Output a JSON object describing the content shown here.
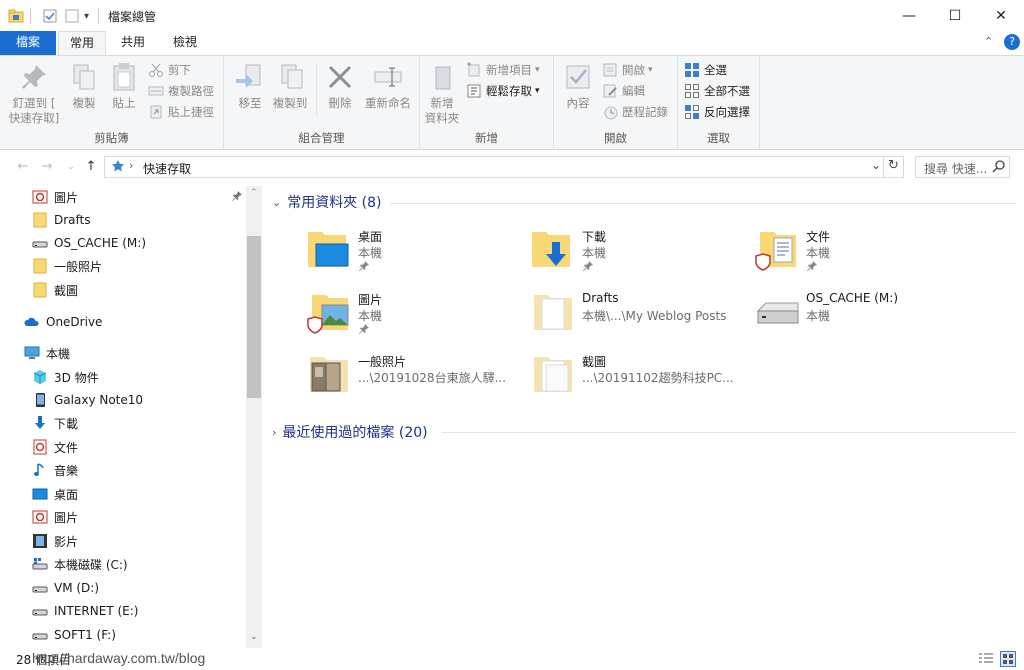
{
  "window": {
    "title": "檔案總管",
    "minimize": "—",
    "maximize": "☐",
    "close": "✕"
  },
  "tabs": [
    {
      "label": "檔案"
    },
    {
      "label": "常用"
    },
    {
      "label": "共用"
    },
    {
      "label": "檢視"
    }
  ],
  "ribbon": {
    "groups": {
      "clipboard": "剪貼簿",
      "organize": "組合管理",
      "new": "新增",
      "open": "開啟",
      "select": "選取"
    },
    "buttons": {
      "pin_line1": "釘選到 [",
      "pin_line2": "快速存取]",
      "copy": "複製",
      "paste": "貼上",
      "cut": "剪下",
      "copy_path": "複製路徑",
      "paste_shortcut": "貼上捷徑",
      "move_to": "移至",
      "copy_to": "複製到",
      "delete": "刪除",
      "rename": "重新命名",
      "new_folder_line1": "新增",
      "new_folder_line2": "資料夾",
      "new_item": "新增項目",
      "easy_access": "輕鬆存取",
      "properties": "內容",
      "open": "開啟",
      "edit": "編輯",
      "history": "歷程記錄",
      "select_all": "全選",
      "select_none": "全部不選",
      "invert_selection": "反向選擇"
    }
  },
  "address": {
    "path": "快速存取",
    "search_placeholder": "搜尋 快速..."
  },
  "navpane": {
    "items": [
      {
        "label": "圖片",
        "icon": "pictures-icon"
      },
      {
        "label": "Drafts",
        "icon": "folder-icon"
      },
      {
        "label": "OS_CACHE (M:)",
        "icon": "drive-icon"
      },
      {
        "label": "一般照片",
        "icon": "folder-icon"
      },
      {
        "label": "截圖",
        "icon": "folder-icon"
      },
      {
        "label": "OneDrive",
        "icon": "onedrive-icon"
      },
      {
        "label": "本機",
        "icon": "computer-icon"
      },
      {
        "label": "3D 物件",
        "icon": "3d-objects-icon"
      },
      {
        "label": "Galaxy Note10",
        "icon": "phone-icon"
      },
      {
        "label": "下載",
        "icon": "downloads-icon"
      },
      {
        "label": "文件",
        "icon": "documents-icon"
      },
      {
        "label": "音樂",
        "icon": "music-icon"
      },
      {
        "label": "桌面",
        "icon": "desktop-icon"
      },
      {
        "label": "圖片",
        "icon": "pictures-icon"
      },
      {
        "label": "影片",
        "icon": "videos-icon"
      },
      {
        "label": "本機磁碟 (C:)",
        "icon": "system-drive-icon"
      },
      {
        "label": "VM (D:)",
        "icon": "drive-icon"
      },
      {
        "label": "INTERNET (E:)",
        "icon": "drive-icon"
      },
      {
        "label": "SOFT1 (F:)",
        "icon": "drive-icon"
      }
    ]
  },
  "content": {
    "frequent_header": "常用資料夾 (8)",
    "recent_header": "最近使用過的檔案 (20)",
    "tiles": [
      {
        "name": "桌面",
        "sub": "本機"
      },
      {
        "name": "下載",
        "sub": "本機"
      },
      {
        "name": "文件",
        "sub": "本機"
      },
      {
        "name": "圖片",
        "sub": "本機"
      },
      {
        "name": "Drafts",
        "sub": "本機\\...\\My Weblog Posts"
      },
      {
        "name": "OS_CACHE (M:)",
        "sub": "本機"
      },
      {
        "name": "一般照片",
        "sub": "...\\20191028台東旅人驛..."
      },
      {
        "name": "截圖",
        "sub": "...\\20191102趨勢科技PC..."
      }
    ]
  },
  "status": {
    "count": "28 個項目",
    "watermark": "http://hardaway.com.tw/blog"
  },
  "colors": {
    "accent": "#1a6ed1",
    "header_text": "#1e3287",
    "folder": "#f8d775"
  }
}
